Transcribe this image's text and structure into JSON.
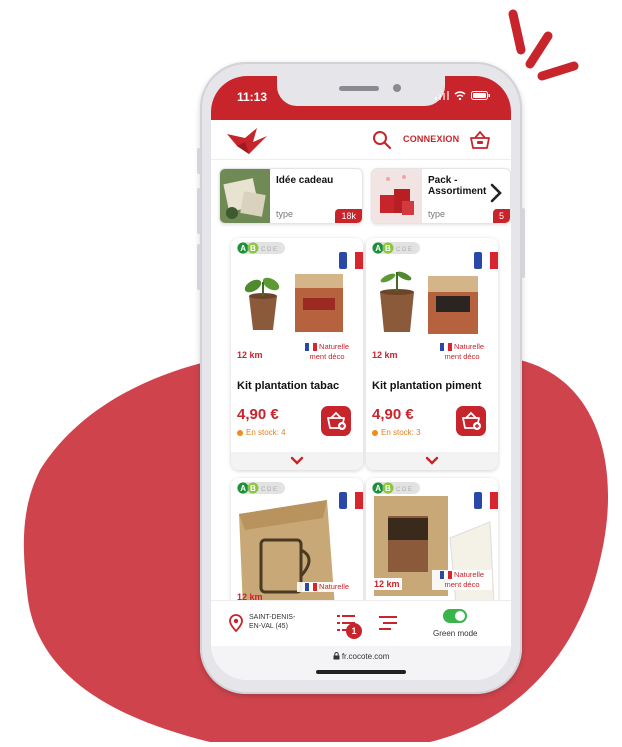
{
  "colors": {
    "brand_red": "#c8242b",
    "blob_red": "#cf444c",
    "toggle_green": "#39b54a",
    "stock_orange": "#f08c1a"
  },
  "status": {
    "time": "11:13"
  },
  "header": {
    "logo_icon": "cocote-bird-logo",
    "search_icon": "search-icon",
    "connexion_label": "CONNEXION",
    "basket_icon": "basket-icon"
  },
  "carousel": [
    {
      "title": "Idée cadeau",
      "type": "type",
      "badge": "18k"
    },
    {
      "title": "Pack - Assortiment",
      "type": "type",
      "badge": "5"
    }
  ],
  "products": [
    {
      "name": "Kit plantation tabac",
      "price": "4,90 €",
      "stock": "En stock: 4",
      "distance": "12 km",
      "tag": "Naturelle ment déco",
      "nutri": [
        "A",
        "B",
        "C",
        "D",
        "E"
      ]
    },
    {
      "name": "Kit plantation piment",
      "price": "4,90 €",
      "stock": "En stock: 3",
      "distance": "12 km",
      "tag": "Naturelle ment déco",
      "nutri": [
        "A",
        "B",
        "C",
        "D",
        "E"
      ]
    },
    {
      "name": "",
      "price": "",
      "stock": "",
      "distance": "12 km",
      "tag": "Naturelle",
      "nutri": [
        "A",
        "B",
        "C",
        "D",
        "E"
      ]
    },
    {
      "name": "",
      "price": "",
      "stock": "",
      "distance": "12 km",
      "tag": "Naturelle ment déco",
      "nutri": [
        "A",
        "B",
        "C",
        "D",
        "E"
      ]
    }
  ],
  "bottom": {
    "location": "SAINT-DENIS-EN-VAL (45)",
    "list_badge": "1",
    "green_mode_label": "Green mode",
    "green_mode_on": true
  },
  "browser": {
    "url": "fr.cocote.com"
  }
}
